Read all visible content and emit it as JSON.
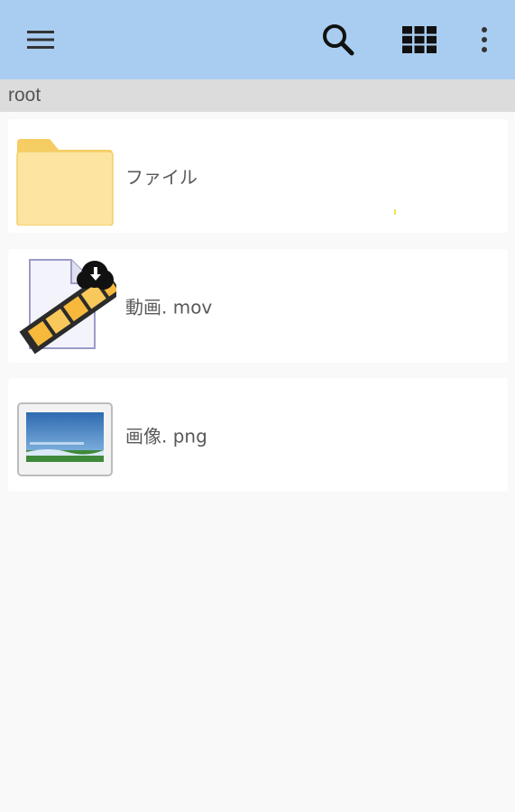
{
  "breadcrumb": {
    "path": "root"
  },
  "files": [
    {
      "name": "ファイル",
      "icon": "folder-icon"
    },
    {
      "name": "動画. mov",
      "icon": "video-file-download-icon"
    },
    {
      "name": "画像. png",
      "icon": "image-file-icon"
    }
  ],
  "toolbar": {
    "menu_icon": "hamburger-menu-icon",
    "search_icon": "search-icon",
    "grid_icon": "grid-view-icon",
    "more_icon": "more-vert-icon"
  },
  "colors": {
    "appbar": "#a9cdf0",
    "breadcrumb_bar": "#dcdcdc",
    "background": "#f9f9f9",
    "folder": "#fbe29a"
  }
}
